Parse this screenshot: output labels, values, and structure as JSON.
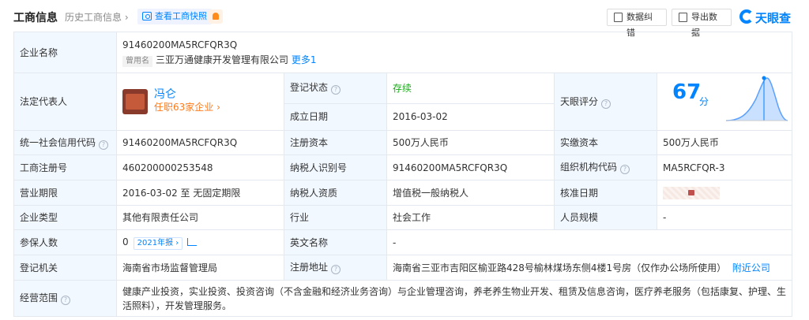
{
  "header": {
    "title": "工商信息",
    "history": "历史工商信息 ›",
    "snapshot": "查看工商快照",
    "correct": "数据纠错",
    "export": "导出数据",
    "brand": "天眼查"
  },
  "company_name": {
    "label": "企业名称",
    "value": "91460200MA5RCFQR3Q",
    "alias_tag": "曾用名",
    "alias": "三亚万通健康开发管理有限公司",
    "more": "更多1"
  },
  "legal_rep": {
    "label": "法定代表人",
    "name": "冯仑",
    "positions": "任职63家企业 ›"
  },
  "reg_status": {
    "label": "登记状态",
    "value": "存续"
  },
  "est_date": {
    "label": "成立日期",
    "value": "2016-03-02"
  },
  "tianyan_score": {
    "label": "天眼评分",
    "value": "67",
    "unit": "分"
  },
  "credit_code": {
    "label": "统一社会信用代码",
    "value": "91460200MA5RCFQR3Q"
  },
  "reg_capital": {
    "label": "注册资本",
    "value": "500万人民币"
  },
  "paid_capital": {
    "label": "实缴资本",
    "value": "500万人民币"
  },
  "reg_number": {
    "label": "工商注册号",
    "value": "460200000253548"
  },
  "taxpayer_id": {
    "label": "纳税人识别号",
    "value": "91460200MA5RCFQR3Q"
  },
  "org_code": {
    "label": "组织机构代码",
    "value": "MA5RCFQR-3"
  },
  "term": {
    "label": "营业期限",
    "value": "2016-03-02 至 无固定期限"
  },
  "taxpayer_qual": {
    "label": "纳税人资质",
    "value": "增值税一般纳税人"
  },
  "approve_date": {
    "label": "核准日期"
  },
  "company_type": {
    "label": "企业类型",
    "value": "其他有限责任公司"
  },
  "industry": {
    "label": "行业",
    "value": "社会工作"
  },
  "staff_size": {
    "label": "人员规模",
    "value": "-"
  },
  "insured": {
    "label": "参保人数",
    "value": "0",
    "year": "2021年报 ›"
  },
  "english_name": {
    "label": "英文名称",
    "value": "-"
  },
  "authority": {
    "label": "登记机关",
    "value": "海南省市场监督管理局"
  },
  "address": {
    "label": "注册地址",
    "value": "海南省三亚市吉阳区榆亚路428号榆林煤场东侧4楼1号房（仅作办公场所使用）",
    "nearby": "附近公司"
  },
  "scope": {
    "label": "经营范围",
    "value": "健康产业投资，实业投资、投资咨询（不含金融和经济业务咨询）与企业管理咨询，养老养生物业开发、租赁及信息咨询，医疗养老服务（包括康复、护理、生活照料），开发管理服务。"
  }
}
